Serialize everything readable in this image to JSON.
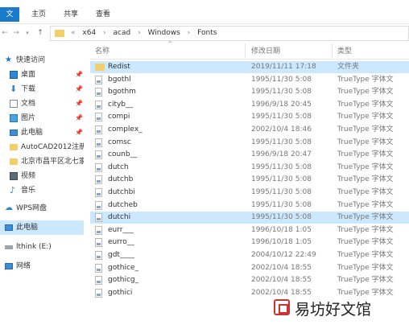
{
  "ribbon": {
    "tabs": [
      "文件",
      "主页",
      "共享",
      "查看"
    ]
  },
  "address": {
    "crumbs": [
      "«",
      "x64",
      "acad",
      "Windows",
      "Fonts"
    ]
  },
  "nav_pane": {
    "items": [
      {
        "label": "快速访问",
        "icon": "star-icon"
      },
      {
        "label": "桌面",
        "icon": "desktop-icon",
        "pinned": true
      },
      {
        "label": "下载",
        "icon": "download-icon",
        "pinned": true
      },
      {
        "label": "文档",
        "icon": "document-icon",
        "pinned": true
      },
      {
        "label": "图片",
        "icon": "picture-icon",
        "pinned": true
      },
      {
        "label": "此电脑",
        "icon": "computer-icon",
        "pinned": true
      },
      {
        "label": "AutoCAD2012注册",
        "icon": "folder-icon"
      },
      {
        "label": "北京市昌平区北七家",
        "icon": "folder-icon"
      },
      {
        "label": "视频",
        "icon": "video-icon"
      },
      {
        "label": "音乐",
        "icon": "music-icon"
      },
      {
        "label": "WPS网盘",
        "icon": "cloud-icon"
      },
      {
        "label": "此电脑",
        "icon": "computer-icon",
        "selected": true
      },
      {
        "label": "lthink (E:)",
        "icon": "drive-icon"
      },
      {
        "label": "网络",
        "icon": "network-icon"
      }
    ]
  },
  "columns": {
    "name": "名称",
    "date": "修改日期",
    "type": "类型"
  },
  "files": [
    {
      "name": "Redist",
      "date": "2019/11/11 17:18",
      "type": "文件夹",
      "folder": true,
      "selected": true
    },
    {
      "name": "bgothl",
      "date": "1995/11/30 5:08",
      "type": "TrueType 字体文"
    },
    {
      "name": "bgothm",
      "date": "1995/11/30 5:08",
      "type": "TrueType 字体文"
    },
    {
      "name": "cityb__",
      "date": "1996/9/18 20:45",
      "type": "TrueType 字体文"
    },
    {
      "name": "compi",
      "date": "1995/11/30 5:08",
      "type": "TrueType 字体文"
    },
    {
      "name": "complex_",
      "date": "2002/10/4 18:46",
      "type": "TrueType 字体文"
    },
    {
      "name": "comsc",
      "date": "1995/11/30 5:08",
      "type": "TrueType 字体文"
    },
    {
      "name": "counb__",
      "date": "1996/9/18 20:47",
      "type": "TrueType 字体文"
    },
    {
      "name": "dutch",
      "date": "1995/11/30 5:08",
      "type": "TrueType 字体文"
    },
    {
      "name": "dutchb",
      "date": "1995/11/30 5:08",
      "type": "TrueType 字体文"
    },
    {
      "name": "dutchbi",
      "date": "1995/11/30 5:08",
      "type": "TrueType 字体文"
    },
    {
      "name": "dutcheb",
      "date": "1995/11/30 5:08",
      "type": "TrueType 字体文"
    },
    {
      "name": "dutchi",
      "date": "1995/11/30 5:08",
      "type": "TrueType 字体文",
      "selected": true
    },
    {
      "name": "eurr___",
      "date": "1996/10/18 1:05",
      "type": "TrueType 字体文"
    },
    {
      "name": "eurro__",
      "date": "1996/10/18 1:05",
      "type": "TrueType 字体文"
    },
    {
      "name": "gdt____",
      "date": "2004/10/12 22:49",
      "type": "TrueType 字体文"
    },
    {
      "name": "gothice_",
      "date": "2002/10/4 18:55",
      "type": "TrueType 字体文"
    },
    {
      "name": "gothicg_",
      "date": "2002/10/4 18:55",
      "type": "TrueType 字体文"
    },
    {
      "name": "gothici",
      "date": "2002/10/4 18:55",
      "type": "TrueType 字体文"
    }
  ],
  "watermark": "易坊好文馆"
}
